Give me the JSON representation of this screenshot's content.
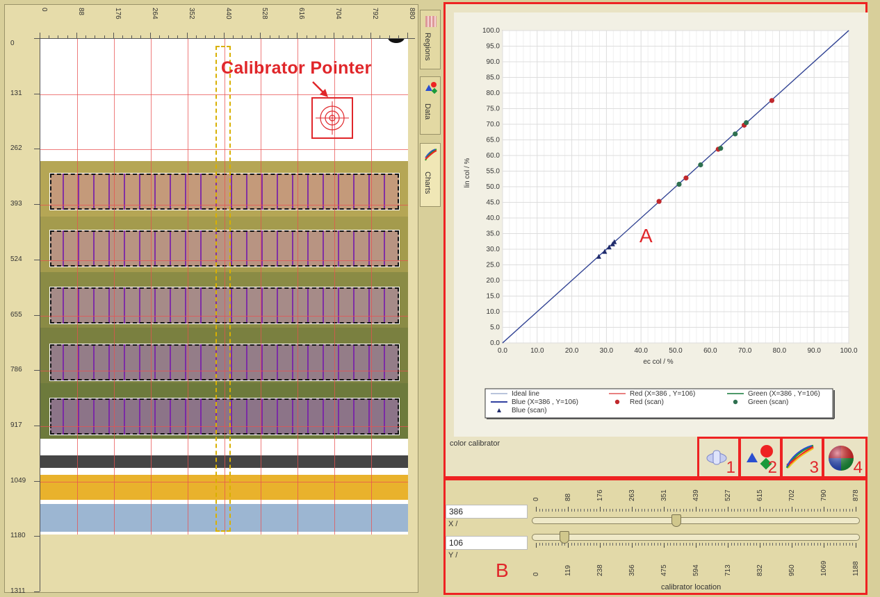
{
  "viewer": {
    "top_ruler_ticks": [
      "0",
      "88",
      "176",
      "264",
      "352",
      "440",
      "528",
      "616",
      "704",
      "792",
      "880"
    ],
    "left_ruler_ticks": [
      "0",
      "131",
      "262",
      "393",
      "524",
      "655",
      "786",
      "917",
      "1049",
      "1180",
      "1311"
    ],
    "calibrator_label": "Calibrator Pointer"
  },
  "tabs": [
    {
      "label": "Regions",
      "icon": "grid-icon"
    },
    {
      "label": "Data",
      "icon": "shapes-icon"
    },
    {
      "label": "Charts",
      "icon": "chart-curve-icon"
    }
  ],
  "chart_section": {
    "caption": "color calibrator",
    "label_A": "A"
  },
  "chart_data": {
    "type": "scatter",
    "xlabel": "ec col / %",
    "ylabel": "lin col / %",
    "xlim": [
      0,
      100
    ],
    "ylim": [
      0,
      100
    ],
    "x_ticks": [
      "0.0",
      "10.0",
      "20.0",
      "30.0",
      "40.0",
      "50.0",
      "60.0",
      "70.0",
      "80.0",
      "90.0",
      "100.0"
    ],
    "y_ticks": [
      "0.0",
      "5.0",
      "10.0",
      "15.0",
      "20.0",
      "25.0",
      "30.0",
      "35.0",
      "40.0",
      "45.0",
      "50.0",
      "55.0",
      "60.0",
      "65.0",
      "70.0",
      "75.0",
      "80.0",
      "85.0",
      "90.0",
      "95.0",
      "100.0"
    ],
    "grid": true,
    "legend_position": "bottom",
    "series": [
      {
        "name": "Ideal line",
        "kind": "line",
        "color": "#b8c4dc",
        "x": [
          0,
          100
        ],
        "y": [
          0,
          100
        ]
      },
      {
        "name": "Red (X=386 , Y=106)",
        "kind": "line",
        "color": "#e88080",
        "x": [
          0,
          100
        ],
        "y": [
          0,
          100
        ]
      },
      {
        "name": "Green (X=386 , Y=106)",
        "kind": "line",
        "color": "#4e9a6a",
        "x": [
          0,
          100
        ],
        "y": [
          0,
          100
        ]
      },
      {
        "name": "Blue (X=386 , Y=106)",
        "kind": "line",
        "color": "#3040a0",
        "x": [
          0,
          100
        ],
        "y": [
          0,
          100
        ]
      },
      {
        "name": "Red (scan)",
        "kind": "point",
        "color": "#c0282c",
        "x": [
          45.2,
          53.0,
          62.3,
          69.8,
          77.8
        ],
        "y": [
          45.3,
          52.8,
          62.0,
          69.7,
          77.6
        ]
      },
      {
        "name": "Green (scan)",
        "kind": "point",
        "color": "#2e7050",
        "x": [
          51.0,
          57.2,
          63.0,
          67.2,
          70.4
        ],
        "y": [
          50.8,
          57.0,
          62.3,
          66.9,
          70.5
        ]
      },
      {
        "name": "Blue (scan)",
        "kind": "triangle",
        "color": "#202c6c",
        "x": [
          27.8,
          29.5,
          30.8,
          31.8,
          32.3
        ],
        "y": [
          27.6,
          29.2,
          30.6,
          31.6,
          32.3
        ]
      }
    ]
  },
  "toolbar": [
    {
      "number": "1",
      "icon": "pill-icon"
    },
    {
      "number": "2",
      "icon": "shapes-icon"
    },
    {
      "number": "3",
      "icon": "chart-curve-icon"
    },
    {
      "number": "4",
      "icon": "color-sphere-icon"
    }
  ],
  "location": {
    "x_value": "386",
    "y_value": "106",
    "x_label": "X /",
    "y_label": "Y /",
    "x_ticks": [
      "0",
      "88",
      "176",
      "263",
      "351",
      "439",
      "527",
      "615",
      "702",
      "790",
      "878"
    ],
    "y_ticks": [
      "0",
      "119",
      "238",
      "356",
      "475",
      "594",
      "713",
      "832",
      "950",
      "1069",
      "1188"
    ],
    "x_range": [
      0,
      878
    ],
    "y_range": [
      0,
      1188
    ],
    "footer": "calibrator location",
    "label_B": "B"
  }
}
